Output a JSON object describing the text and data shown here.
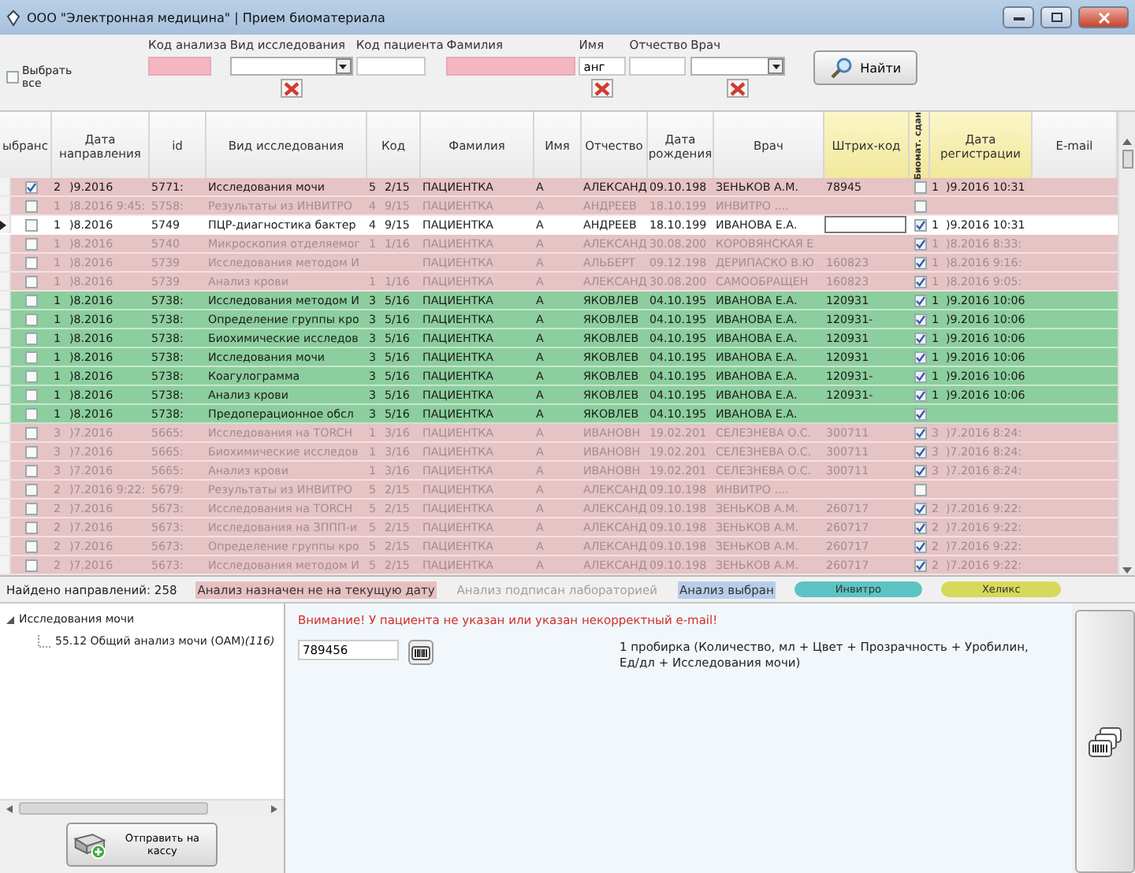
{
  "window": {
    "title": "ООО \"Электронная медицина\" | Прием биоматериала"
  },
  "filters": {
    "select_all": {
      "label": "Выбрать все",
      "checked": false
    },
    "fields": [
      {
        "label": "Код анализа",
        "kind": "input",
        "highlighted": true,
        "clearable": false
      },
      {
        "label": "Вид исследования",
        "kind": "dropdown",
        "highlighted": false,
        "clearable": true
      },
      {
        "label": "Код пациента",
        "kind": "input",
        "highlighted": false,
        "clearable": false
      },
      {
        "label": "Фамилия",
        "kind": "input",
        "highlighted": true,
        "clearable": false
      },
      {
        "label": "Имя",
        "kind": "input",
        "highlighted": false,
        "clearable": true,
        "value": "анг"
      },
      {
        "label": "Отчество",
        "kind": "input",
        "highlighted": false,
        "clearable": false
      },
      {
        "label": "Врач",
        "kind": "dropdown",
        "highlighted": false,
        "clearable": true
      }
    ],
    "search_button": "Найти"
  },
  "table": {
    "columns": [
      {
        "label": "ыбранс",
        "highlighted": false,
        "vertical": false
      },
      {
        "label": "Дата направления",
        "highlighted": false,
        "vertical": false
      },
      {
        "label": "id",
        "highlighted": false,
        "vertical": false
      },
      {
        "label": "Вид исследования",
        "highlighted": false,
        "vertical": false
      },
      {
        "label": "Код",
        "highlighted": false,
        "vertical": false
      },
      {
        "label": "Фамилия",
        "highlighted": false,
        "vertical": false
      },
      {
        "label": "Имя",
        "highlighted": false,
        "vertical": false
      },
      {
        "label": "Отчество",
        "highlighted": false,
        "vertical": false
      },
      {
        "label": "Дата рождения",
        "highlighted": false,
        "vertical": false
      },
      {
        "label": "Врач",
        "highlighted": false,
        "vertical": false
      },
      {
        "label": "Штрих-код",
        "highlighted": true,
        "vertical": false
      },
      {
        "label": "Биомат. сдан",
        "highlighted": true,
        "vertical": true
      },
      {
        "label": "Дата регистрации",
        "highlighted": true,
        "vertical": false
      },
      {
        "label": "E-mail",
        "highlighted": false,
        "vertical": false
      }
    ],
    "rows": [
      {
        "color": "#e6c3c5",
        "faded": false,
        "current": false,
        "checked": true,
        "biomaterial": false,
        "barcode_field": false,
        "n": "2",
        "date": ")9.2016",
        "id": "5771:",
        "test": "Исследования мочи",
        "qty": "5",
        "code": "2/15",
        "surname": "ПАЦИЕНТКА",
        "name": "А",
        "patronymic": "АЛЕКСАНД",
        "birth": "09.10.198",
        "doctor": "ЗЕНЬКОВ А.М.",
        "barcode": "78945",
        "reg_n": "1",
        "reg_date": ")9.2016 10:31"
      },
      {
        "color": "#e6c3c5",
        "faded": true,
        "current": false,
        "checked": false,
        "biomaterial": false,
        "barcode_field": false,
        "n": "1",
        "date": ")8.2016 9:45:",
        "id": "5758:",
        "test": "Результаты из ИНВИТРО",
        "qty": "4",
        "code": "9/15",
        "surname": "ПАЦИЕНТКА",
        "name": "А",
        "patronymic": "АНДРЕЕВ",
        "birth": "18.10.199",
        "doctor": "ИНВИТРО ...."
      },
      {
        "color": "#ffffff",
        "faded": false,
        "current": true,
        "checked": false,
        "biomaterial": true,
        "barcode_field": true,
        "n": "1",
        "date": ")8.2016",
        "id": "5749",
        "test": "ПЦР-диагностика бактер",
        "qty": "4",
        "code": "9/15",
        "surname": "ПАЦИЕНТКА",
        "name": "А",
        "patronymic": "АНДРЕЕВ",
        "birth": "18.10.199",
        "doctor": "ИВАНОВА Е.А.",
        "reg_n": "1",
        "reg_date": ")9.2016 10:31"
      },
      {
        "color": "#e6c3c5",
        "faded": true,
        "current": false,
        "checked": false,
        "biomaterial": true,
        "barcode_field": false,
        "n": "1",
        "date": ")8.2016",
        "id": "5740",
        "test": "Микроскопия отделяемог",
        "qty": "1",
        "code": "1/16",
        "surname": "ПАЦИЕНТКА",
        "name": "А",
        "patronymic": "АЛЕКСАНД",
        "birth": "30.08.200",
        "doctor": "КОРОВЯНСКАЯ Е",
        "reg_n": "1",
        "reg_date": ")8.2016 8:33:"
      },
      {
        "color": "#e6c3c5",
        "faded": true,
        "current": false,
        "checked": false,
        "biomaterial": true,
        "barcode_field": false,
        "n": "1",
        "date": ")8.2016",
        "id": "5739",
        "test": "Исследования методом И",
        "surname": "ПАЦИЕНТКА",
        "name": "А",
        "patronymic": "АЛЬБЕРТ",
        "birth": "09.12.198",
        "doctor": "ДЕРИПАСКО В.Ю",
        "barcode": "160823",
        "reg_n": "1",
        "reg_date": ")8.2016 9:16:"
      },
      {
        "color": "#e6c3c5",
        "faded": true,
        "current": false,
        "checked": false,
        "biomaterial": true,
        "barcode_field": false,
        "n": "1",
        "date": ")8.2016",
        "id": "5739",
        "test": "Анализ крови",
        "qty": "1",
        "code": "1/16",
        "surname": "ПАЦИЕНТКА",
        "name": "А",
        "patronymic": "АЛЕКСАНД",
        "birth": "30.08.200",
        "doctor": "САМООБРАЩЕН",
        "barcode": "160823",
        "reg_n": "1",
        "reg_date": ")8.2016 9:05:"
      },
      {
        "color": "#8cce9d",
        "faded": false,
        "current": false,
        "checked": false,
        "biomaterial": true,
        "barcode_field": false,
        "n": "1",
        "date": ")8.2016",
        "id": "5738:",
        "test": "Исследования методом И",
        "qty": "3",
        "code": "5/16",
        "surname": "ПАЦИЕНТКА",
        "name": "А",
        "patronymic": "ЯКОВЛЕВ",
        "birth": "04.10.195",
        "doctor": "ИВАНОВА Е.А.",
        "barcode": "120931",
        "reg_n": "1",
        "reg_date": ")9.2016 10:06"
      },
      {
        "color": "#8cce9d",
        "faded": false,
        "current": false,
        "checked": false,
        "biomaterial": true,
        "barcode_field": false,
        "n": "1",
        "date": ")8.2016",
        "id": "5738:",
        "test": "Определение группы кро",
        "qty": "3",
        "code": "5/16",
        "surname": "ПАЦИЕНТКА",
        "name": "А",
        "patronymic": "ЯКОВЛЕВ",
        "birth": "04.10.195",
        "doctor": "ИВАНОВА Е.А.",
        "barcode": "120931-",
        "reg_n": "1",
        "reg_date": ")9.2016 10:06"
      },
      {
        "color": "#8cce9d",
        "faded": false,
        "current": false,
        "checked": false,
        "biomaterial": true,
        "barcode_field": false,
        "n": "1",
        "date": ")8.2016",
        "id": "5738:",
        "test": "Биохимические исследов",
        "qty": "3",
        "code": "5/16",
        "surname": "ПАЦИЕНТКА",
        "name": "А",
        "patronymic": "ЯКОВЛЕВ",
        "birth": "04.10.195",
        "doctor": "ИВАНОВА Е.А.",
        "barcode": "120931",
        "reg_n": "1",
        "reg_date": ")9.2016 10:06"
      },
      {
        "color": "#8cce9d",
        "faded": false,
        "current": false,
        "checked": false,
        "biomaterial": true,
        "barcode_field": false,
        "n": "1",
        "date": ")8.2016",
        "id": "5738:",
        "test": "Исследования мочи",
        "qty": "3",
        "code": "5/16",
        "surname": "ПАЦИЕНТКА",
        "name": "А",
        "patronymic": "ЯКОВЛЕВ",
        "birth": "04.10.195",
        "doctor": "ИВАНОВА Е.А.",
        "barcode": "120931",
        "reg_n": "1",
        "reg_date": ")9.2016 10:06"
      },
      {
        "color": "#8cce9d",
        "faded": false,
        "current": false,
        "checked": false,
        "biomaterial": true,
        "barcode_field": false,
        "n": "1",
        "date": ")8.2016",
        "id": "5738:",
        "test": "Коагулограмма",
        "qty": "3",
        "code": "5/16",
        "surname": "ПАЦИЕНТКА",
        "name": "А",
        "patronymic": "ЯКОВЛЕВ",
        "birth": "04.10.195",
        "doctor": "ИВАНОВА Е.А.",
        "barcode": "120931-",
        "reg_n": "1",
        "reg_date": ")9.2016 10:06"
      },
      {
        "color": "#8cce9d",
        "faded": false,
        "current": false,
        "checked": false,
        "biomaterial": true,
        "barcode_field": false,
        "n": "1",
        "date": ")8.2016",
        "id": "5738:",
        "test": "Анализ крови",
        "qty": "3",
        "code": "5/16",
        "surname": "ПАЦИЕНТКА",
        "name": "А",
        "patronymic": "ЯКОВЛЕВ",
        "birth": "04.10.195",
        "doctor": "ИВАНОВА Е.А.",
        "barcode": "120931-",
        "reg_n": "1",
        "reg_date": ")9.2016 10:06"
      },
      {
        "color": "#8cce9d",
        "faded": false,
        "current": false,
        "checked": false,
        "biomaterial": true,
        "barcode_field": false,
        "n": "1",
        "date": ")8.2016",
        "id": "5738:",
        "test": "Предоперационное обсл",
        "qty": "3",
        "code": "5/16",
        "surname": "ПАЦИЕНТКА",
        "name": "А",
        "patronymic": "ЯКОВЛЕВ",
        "birth": "04.10.195",
        "doctor": "ИВАНОВА Е.А."
      },
      {
        "color": "#e6c3c5",
        "faded": true,
        "current": false,
        "checked": false,
        "biomaterial": true,
        "barcode_field": false,
        "n": "3",
        "date": ")7.2016",
        "id": "5665:",
        "test": "Исследования на TORCH",
        "qty": "1",
        "code": "3/16",
        "surname": "ПАЦИЕНТКА",
        "name": "А",
        "patronymic": "ИВАНОВН",
        "birth": "19.02.201",
        "doctor": "СЕЛЕЗНЕВА О.С.",
        "barcode": "300711",
        "reg_n": "3",
        "reg_date": ")7.2016 8:24:"
      },
      {
        "color": "#e6c3c5",
        "faded": true,
        "current": false,
        "checked": false,
        "biomaterial": true,
        "barcode_field": false,
        "n": "3",
        "date": ")7.2016",
        "id": "5665:",
        "test": "Биохимические исследов",
        "qty": "1",
        "code": "3/16",
        "surname": "ПАЦИЕНТКА",
        "name": "А",
        "patronymic": "ИВАНОВН",
        "birth": "19.02.201",
        "doctor": "СЕЛЕЗНЕВА О.С.",
        "barcode": "300711",
        "reg_n": "3",
        "reg_date": ")7.2016 8:24:"
      },
      {
        "color": "#e6c3c5",
        "faded": true,
        "current": false,
        "checked": false,
        "biomaterial": true,
        "barcode_field": false,
        "n": "3",
        "date": ")7.2016",
        "id": "5665:",
        "test": "Анализ крови",
        "qty": "1",
        "code": "3/16",
        "surname": "ПАЦИЕНТКА",
        "name": "А",
        "patronymic": "ИВАНОВН",
        "birth": "19.02.201",
        "doctor": "СЕЛЕЗНЕВА О.С.",
        "barcode": "300711",
        "reg_n": "3",
        "reg_date": ")7.2016 8:24:"
      },
      {
        "color": "#e6c3c5",
        "faded": true,
        "current": false,
        "checked": false,
        "biomaterial": false,
        "barcode_field": false,
        "n": "2",
        "date": ")7.2016 9:22:",
        "id": "5679:",
        "test": "Результаты из ИНВИТРО",
        "qty": "5",
        "code": "2/15",
        "surname": "ПАЦИЕНТКА",
        "name": "А",
        "patronymic": "АЛЕКСАНД",
        "birth": "09.10.198",
        "doctor": "ИНВИТРО ...."
      },
      {
        "color": "#e6c3c5",
        "faded": true,
        "current": false,
        "checked": false,
        "biomaterial": true,
        "barcode_field": false,
        "n": "2",
        "date": ")7.2016",
        "id": "5673:",
        "test": "Исследования на TORCH",
        "qty": "5",
        "code": "2/15",
        "surname": "ПАЦИЕНТКА",
        "name": "А",
        "patronymic": "АЛЕКСАНД",
        "birth": "09.10.198",
        "doctor": "ЗЕНЬКОВ А.М.",
        "barcode": "260717",
        "reg_n": "2",
        "reg_date": ")7.2016 9:22:"
      },
      {
        "color": "#e6c3c5",
        "faded": true,
        "current": false,
        "checked": false,
        "biomaterial": true,
        "barcode_field": false,
        "n": "2",
        "date": ")7.2016",
        "id": "5673:",
        "test": "Исследования на ЗППП-и",
        "qty": "5",
        "code": "2/15",
        "surname": "ПАЦИЕНТКА",
        "name": "А",
        "patronymic": "АЛЕКСАНД",
        "birth": "09.10.198",
        "doctor": "ЗЕНЬКОВ А.М.",
        "barcode": "260717",
        "reg_n": "2",
        "reg_date": ")7.2016 9:22:"
      },
      {
        "color": "#e6c3c5",
        "faded": true,
        "current": false,
        "checked": false,
        "biomaterial": true,
        "barcode_field": false,
        "n": "2",
        "date": ")7.2016",
        "id": "5673:",
        "test": "Определение группы кро",
        "qty": "5",
        "code": "2/15",
        "surname": "ПАЦИЕНТКА",
        "name": "А",
        "patronymic": "АЛЕКСАНД",
        "birth": "09.10.198",
        "doctor": "ЗЕНЬКОВ А.М.",
        "barcode": "260717",
        "reg_n": "2",
        "reg_date": ")7.2016 9:22:"
      },
      {
        "color": "#e6c3c5",
        "faded": true,
        "current": false,
        "checked": false,
        "biomaterial": true,
        "barcode_field": false,
        "n": "2",
        "date": ")7.2016",
        "id": "5673:",
        "test": "Исследования методом И",
        "qty": "5",
        "code": "2/15",
        "surname": "ПАЦИЕНТКА",
        "name": "А",
        "patronymic": "АЛЕКСАНД",
        "birth": "09.10.198",
        "doctor": "ЗЕНЬКОВ А.М.",
        "barcode": "260717",
        "reg_n": "2",
        "reg_date": ")7.2016 9:22:"
      }
    ]
  },
  "legend": {
    "count": "Найдено направлений: 258",
    "items": [
      {
        "label": "Анализ назначен не на текущую дату",
        "kind": "swatch",
        "color": "#e7bfc1"
      },
      {
        "label": "Анализ подписан лабораторией",
        "kind": "faded",
        "color": "#a0a0a0"
      },
      {
        "label": "Анализ выбран",
        "kind": "swatch",
        "color": "#b9cdea"
      },
      {
        "label": "Инвитро",
        "kind": "pill",
        "color": "#5cc3c4"
      },
      {
        "label": "Хеликс",
        "kind": "pill",
        "color": "#d6d95a"
      }
    ]
  },
  "tree": [
    {
      "label": "Исследования мочи",
      "expanded": true,
      "children": [
        {
          "label": "55.12 Общий анализ мочи (ОАМ)*(116)*"
        }
      ]
    }
  ],
  "send_button": "Отправить на кассу",
  "detail": {
    "warning": "Внимание! У пациента не указан или указан некорректный e-mail!",
    "barcode": "789456",
    "description": "1 пробирка (Количество, мл + Цвет + Прозрачность + Уробилин, Ед/дл + Исследования мочи)"
  }
}
